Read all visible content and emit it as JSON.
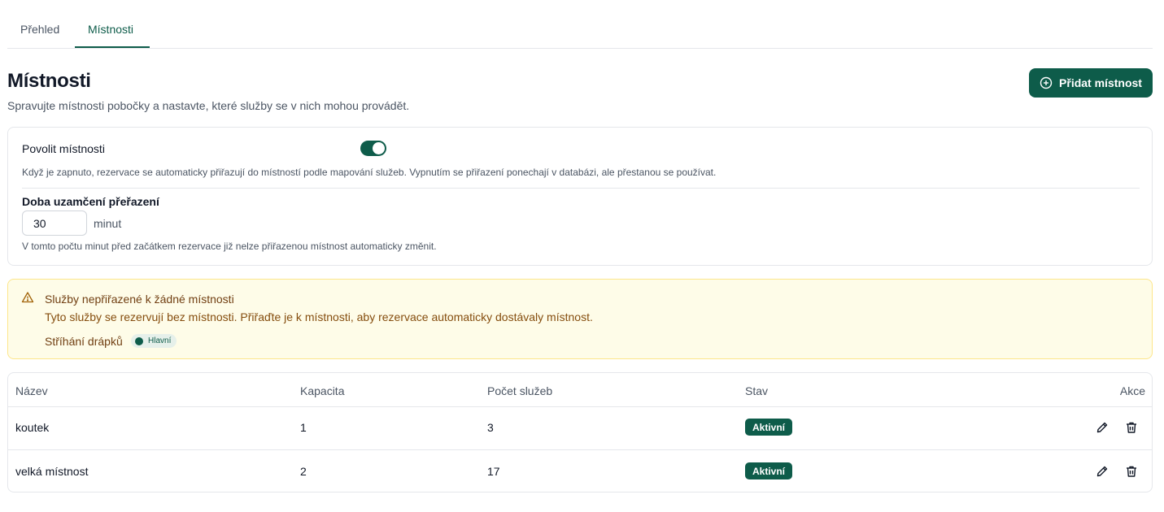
{
  "tabs": [
    {
      "label": "Přehled",
      "active": false
    },
    {
      "label": "Místnosti",
      "active": true
    }
  ],
  "header": {
    "title": "Místnosti",
    "subtitle": "Spravujte místnosti pobočky a nastavte, které služby se v nich mohou provádět.",
    "add_button": "Přidat místnost"
  },
  "settings": {
    "enable_label": "Povolit místnosti",
    "enabled": true,
    "enable_help": "Když je zapnuto, rezervace se automaticky přiřazují do místností podle mapování služeb. Vypnutím se přiřazení ponechají v databázi, ale přestanou se používat.",
    "lock_label": "Doba uzamčení přeřazení",
    "lock_value": "30",
    "lock_unit": "minut",
    "lock_help": "V tomto počtu minut před začátkem rezervace již nelze přiřazenou místnost automaticky změnit."
  },
  "warning": {
    "title": "Služby nepřiřazené k žádné místnosti",
    "text": "Tyto služby se rezervují bez místnosti. Přiřaďte je k místnosti, aby rezervace automaticky dostávaly místnost.",
    "services": [
      {
        "name": "Stříhání drápků",
        "badge": "Hlavní"
      }
    ]
  },
  "table": {
    "columns": [
      "Název",
      "Kapacita",
      "Počet služeb",
      "Stav",
      "Akce"
    ],
    "rows": [
      {
        "name": "koutek",
        "capacity": "1",
        "services": "3",
        "status": "Aktivní"
      },
      {
        "name": "velká místnost",
        "capacity": "2",
        "services": "17",
        "status": "Aktivní"
      }
    ]
  },
  "colors": {
    "accent": "#0e5c4a",
    "warning_bg": "#fefce8",
    "warning_border": "#fde68a",
    "warning_text": "#854d0e"
  },
  "icons": {
    "add": "plus-circle-icon",
    "warning": "alert-triangle-icon",
    "edit": "pencil-icon",
    "delete": "trash-icon"
  }
}
